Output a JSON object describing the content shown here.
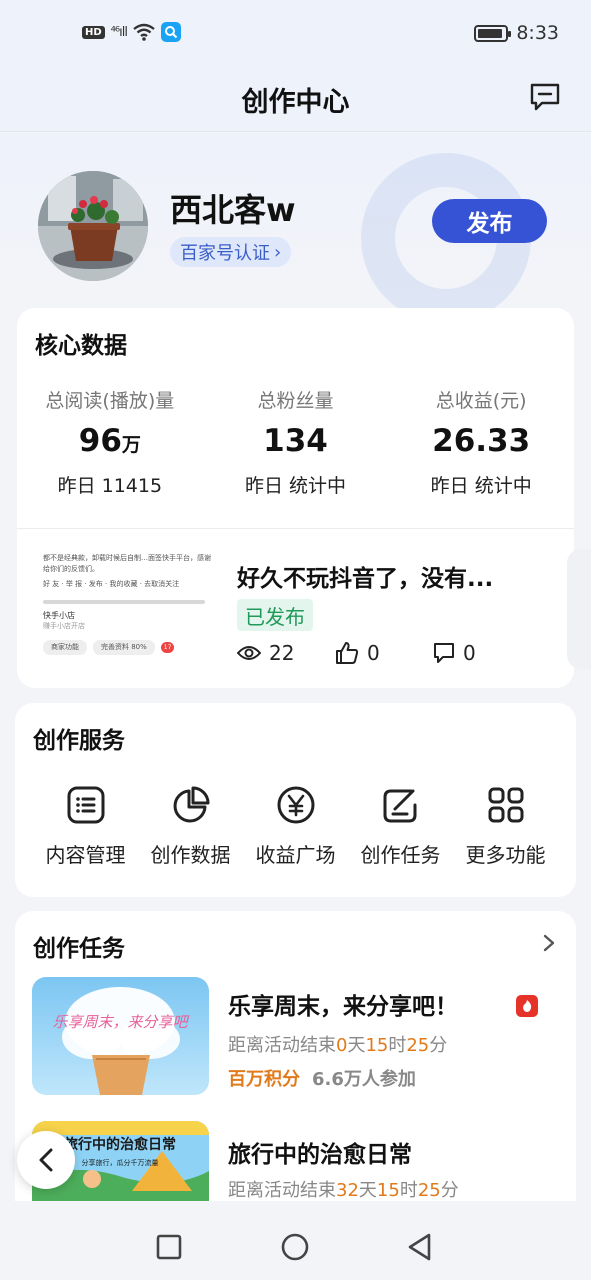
{
  "status_bar": {
    "hd": "HD",
    "signal": "⁴⁶ıll",
    "time": "8:33"
  },
  "header": {
    "title": "创作中心"
  },
  "profile": {
    "name": "西北客w",
    "certification": "百家号认证",
    "publish_label": "发布"
  },
  "core": {
    "title": "核心数据",
    "stats": [
      {
        "label": "总阅读(播放)量",
        "value": "96",
        "unit": "万",
        "sub": "昨日 11415"
      },
      {
        "label": "总粉丝量",
        "value": "134",
        "unit": "",
        "sub": "昨日 统计中"
      },
      {
        "label": "总收益(元)",
        "value": "26.33",
        "unit": "",
        "sub": "昨日 统计中"
      }
    ],
    "article": {
      "title": "好久不玩抖音了，没有...",
      "status": "已发布",
      "views": "22",
      "likes": "0",
      "comments": "0",
      "thumb": {
        "line1": "都不是经典款，卸载时候后自制…面签快手平台，感谢给你们的反馈们。",
        "line2": "好 友 · 举 报 · 发布 · 我的收藏 · 去取消关注",
        "shop": "快手小店",
        "shop_sub": "赚手小店开店",
        "pill1": "商家功能",
        "pill2": "完善资料 80%",
        "notif": "17"
      }
    }
  },
  "services": {
    "title": "创作服务",
    "items": [
      {
        "label": "内容管理",
        "icon": "list-icon"
      },
      {
        "label": "创作数据",
        "icon": "pie-chart-icon"
      },
      {
        "label": "收益广场",
        "icon": "yen-icon"
      },
      {
        "label": "创作任务",
        "icon": "edit-icon"
      },
      {
        "label": "更多功能",
        "icon": "grid-icon"
      }
    ]
  },
  "tasks": {
    "title": "创作任务",
    "items": [
      {
        "title": "乐享周末，来分享吧！",
        "countdown_prefix": "距离活动结束",
        "days": "0",
        "hours": "15",
        "minutes": "25",
        "reward": "百万积分",
        "participants": "6.6万人参加",
        "img_text": "乐享周末，来分享吧"
      },
      {
        "title": "旅行中的治愈日常",
        "countdown_prefix": "距离活动结束",
        "days": "32",
        "hours": "15",
        "minutes": "25",
        "img_text": "旅行中的治愈日常",
        "img_sub": "分享旅行，瓜分千万流量"
      }
    ],
    "unit_day": "天",
    "unit_hour": "时",
    "unit_min": "分"
  },
  "colors": {
    "accent": "#3653d6",
    "orange": "#e27a1b",
    "green": "#1f9a5b"
  }
}
